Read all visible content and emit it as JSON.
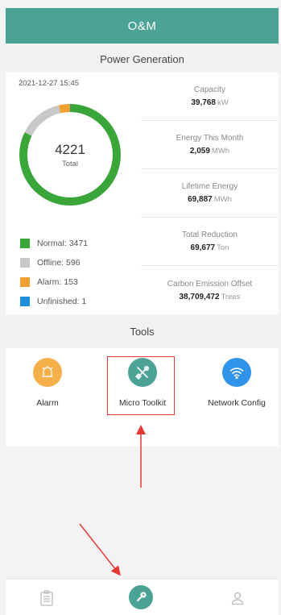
{
  "app": {
    "title": "O&M"
  },
  "power_generation": {
    "header": "Power Generation",
    "datetime": "2021-12-27 15:45",
    "total_value": "4221",
    "total_label": "Total",
    "donut": {
      "normal": 3471,
      "offline": 596,
      "alarm": 153,
      "unfinished": 1
    },
    "legend": [
      {
        "label": "Normal:",
        "value": "3471",
        "color": "#3aa63a"
      },
      {
        "label": "Offline:",
        "value": "596",
        "color": "#c8c8c8"
      },
      {
        "label": "Alarm:",
        "value": "153",
        "color": "#f0a030"
      },
      {
        "label": "Unfinished:",
        "value": "1",
        "color": "#1e8fdc"
      }
    ],
    "stats": [
      {
        "label": "Capacity",
        "value": "39,768",
        "unit": "kW"
      },
      {
        "label": "Energy This Month",
        "value": "2,059",
        "unit": "MWh"
      },
      {
        "label": "Lifetime Energy",
        "value": "69,887",
        "unit": "MWh"
      },
      {
        "label": "Total Reduction",
        "value": "69,677",
        "unit": "Ton"
      },
      {
        "label": "Carbon Emission Offset",
        "value": "38,709,472",
        "unit": "Trees"
      }
    ]
  },
  "tools": {
    "header": "Tools",
    "items": [
      {
        "label": "Alarm",
        "icon": "alarm-bell-icon",
        "color": "#f6b04a"
      },
      {
        "label": "Micro Toolkit",
        "icon": "tools-wrench-screwdriver-icon",
        "color": "#4aa394"
      },
      {
        "label": "Network Config",
        "icon": "wifi-icon",
        "color": "#2f93ea"
      }
    ]
  },
  "bottom_nav": [
    {
      "icon": "report-clipboard-icon"
    },
    {
      "icon": "wrench-icon",
      "active": true,
      "color": "#4aa394"
    },
    {
      "icon": "user-icon"
    }
  ],
  "annotations": {
    "highlight_color": "#e53935"
  }
}
